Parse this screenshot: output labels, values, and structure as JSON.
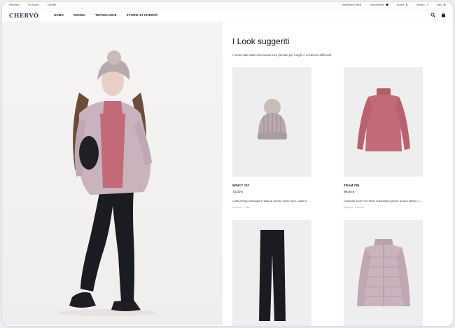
{
  "utility_bar": {
    "links": [
      "Rilevatori",
      "Chi Siamo",
      "Contatti"
    ],
    "right": [
      {
        "label": "Assistenza Clienti",
        "icon": "none"
      },
      {
        "label": "Lista desideri",
        "icon": "heart-icon"
      },
      {
        "label": "Accedi",
        "icon": "user-icon"
      },
      {
        "label": "Italiano",
        "icon": "chevron-down-icon"
      },
      {
        "label": "Italy",
        "icon": "location-icon"
      }
    ]
  },
  "header": {
    "logo": "CHERVÒ",
    "nav": [
      "UOMO",
      "DONNA",
      "TECNOLOGIE",
      "STORIE DI CHERVÒ"
    ]
  },
  "looks": {
    "title": "I Look suggeriti",
    "subtitle": "I nostri capi sotto una nuova luce pensati per luoghi e occasioni differenti.",
    "products": [
      {
        "name": "WINCY 747",
        "price": "73,00 €",
        "description": "Cuffia Wincy realizzata in filato di woman misto nylon, dalla m...",
        "tags": "Accessori · Cuffie"
      },
      {
        "name": "TRAM 789",
        "price": "99,00 €",
        "description": "Dolcevita Tram Pro Hirsch realizzata in jersey tecnico stretch, c...",
        "tags": "Maglieria · Dolcevita"
      },
      {
        "name": "",
        "price": "",
        "description": "",
        "tags": ""
      },
      {
        "name": "",
        "price": "",
        "description": "",
        "tags": ""
      }
    ]
  },
  "colors": {
    "logo": "#2c3e58",
    "jacket": "#c9b3bd",
    "turtleneck": "#c26a78",
    "beanie": "#b9a9ac",
    "pants": "#1b1c21"
  }
}
